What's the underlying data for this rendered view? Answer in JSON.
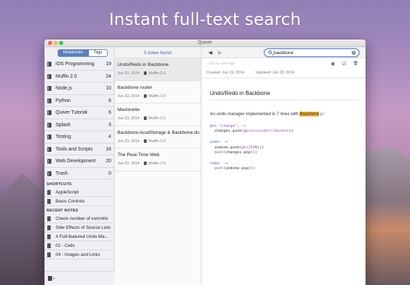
{
  "headline": "Instant full-text search",
  "window": {
    "title": "Quiver"
  },
  "sidebar": {
    "tabs": {
      "active": "Notebooks",
      "inactive": "Tags"
    },
    "notebooks": [
      {
        "label": "iOS Programming",
        "count": "19"
      },
      {
        "label": "Muffin 2.0",
        "count": "24"
      },
      {
        "label": "Node.js",
        "count": "10"
      },
      {
        "label": "Python",
        "count": "6"
      },
      {
        "label": "Quiver Tutorial",
        "count": "6"
      },
      {
        "label": "Splash",
        "count": "3"
      },
      {
        "label": "Testing",
        "count": "4"
      },
      {
        "label": "Tools and Scripts",
        "count": "16"
      },
      {
        "label": "Web Development",
        "count": "20"
      },
      {
        "label": "Trash",
        "count": "0"
      }
    ],
    "shortcuts_heading": "SHORTCUTS",
    "shortcuts": [
      {
        "label": "AppleScript"
      },
      {
        "label": "Basic Controls"
      }
    ],
    "recent_heading": "RECENT NOTES",
    "recent": [
      {
        "label": "Check number of commits"
      },
      {
        "label": "Side Effects of Source Lists"
      },
      {
        "label": "A Full-featured Undo Ma..."
      },
      {
        "label": "02 - Cells"
      },
      {
        "label": "04 - Images and Links"
      }
    ],
    "footer_plus": "+"
  },
  "notes_list": {
    "found_label": "5 notes found",
    "notes": [
      {
        "title": "Undo/Redo in Backbone",
        "date": "Jun 23, 2014",
        "notebook": "Muffin 2.0"
      },
      {
        "title": "Backbone router",
        "date": "Jun 23, 2014",
        "notebook": "Muffin 2.0"
      },
      {
        "title": "Marionette",
        "date": "Jun 23, 2014",
        "notebook": "Muffin 2.0"
      },
      {
        "title": "Backbone.localStorage & Backbone.du...",
        "date": "Jun 23, 2014",
        "notebook": "Muffin 2.0"
      },
      {
        "title": "The Real-Time Web",
        "date": "Jun 23, 2014",
        "notebook": "Muffin 2.0"
      }
    ]
  },
  "editor": {
    "back_glyph": "◀",
    "forward_glyph": "▶",
    "search_value": "backbone",
    "clear_glyph": "×",
    "tags_placeholder": "click to add tags",
    "tool_glyphs": {
      "preview": "◉",
      "checklist": "☑",
      "trash": "🗑"
    },
    "created": "Created: Jun 23, 2014",
    "updated": "Updated: Jun 23, 2014",
    "doc_title": "Undo/Redo in Backbone",
    "para_before": "An ",
    "para_em": "undo manager",
    "para_mid": " implemented in 7 lines with ",
    "para_hl": "Backbone",
    "para_link": ".js",
    "para_colon": ":",
    "code_blocks": [
      {
        "lines": [
          [
            {
              "t": "@on",
              "c": "at"
            },
            {
              "t": " "
            },
            {
              "t": "\"change\"",
              "c": "str"
            },
            {
              "t": ", "
            },
            {
              "t": "->",
              "c": "kw"
            }
          ],
          [
            {
              "t": "  changes.push("
            },
            {
              "t": "@previousAttributes",
              "c": "at"
            },
            {
              "t": "())"
            }
          ]
        ]
      },
      {
        "lines": [
          [
            {
              "t": "undo:",
              "c": "kw"
            },
            {
              "t": " "
            },
            {
              "t": "->",
              "c": "kw"
            }
          ],
          [
            {
              "t": "  undone.push("
            },
            {
              "t": "@toJSON",
              "c": "at"
            },
            {
              "t": "())"
            }
          ],
          [
            {
              "t": "  "
            },
            {
              "t": "@set",
              "c": "at"
            },
            {
              "t": "(changes.pop())"
            }
          ]
        ]
      },
      {
        "lines": [
          [
            {
              "t": "redo:",
              "c": "kw"
            },
            {
              "t": " "
            },
            {
              "t": "->",
              "c": "kw"
            }
          ],
          [
            {
              "t": "  "
            },
            {
              "t": "@set",
              "c": "at"
            },
            {
              "t": "(undone.pop())"
            }
          ]
        ]
      }
    ]
  },
  "colors": {
    "accent": "#5a7ec0",
    "highlight": "#f0b233",
    "link": "#3b6fc4"
  }
}
